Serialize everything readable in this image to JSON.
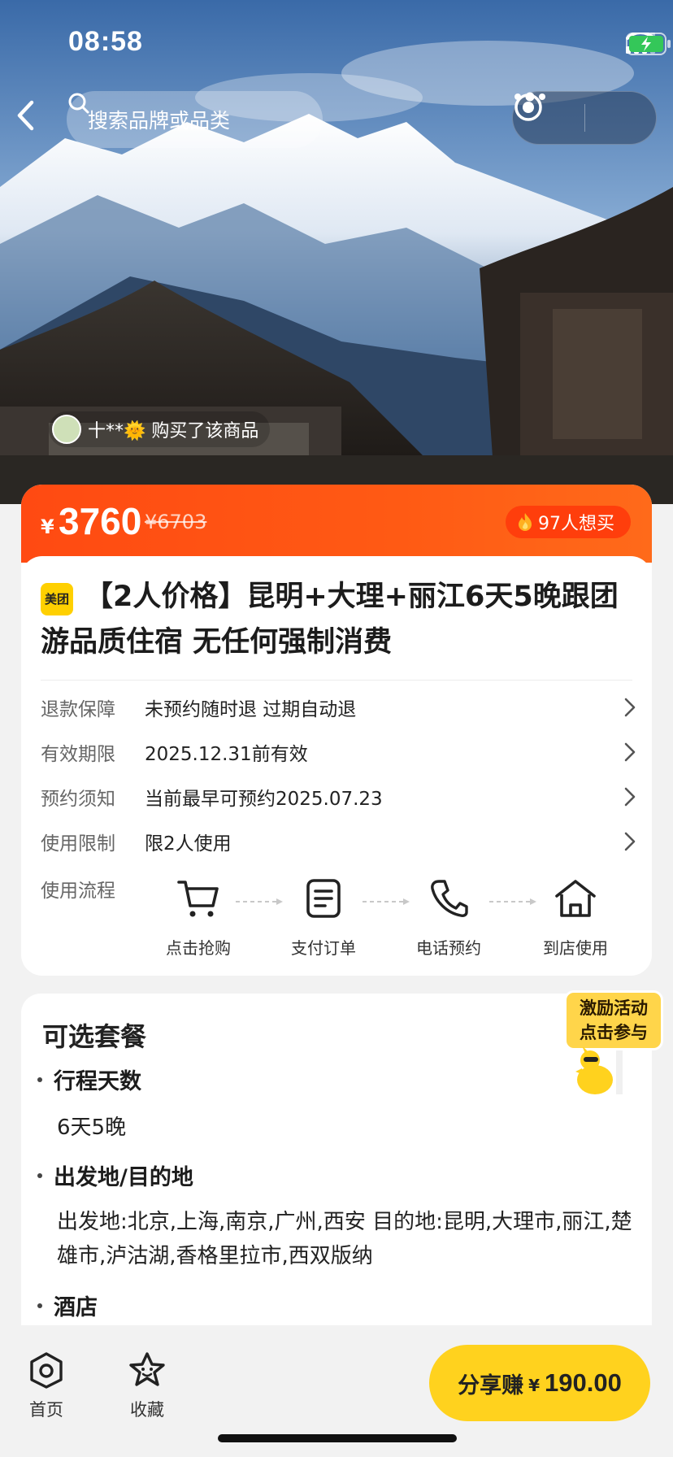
{
  "status_bar": {
    "time": "08:58"
  },
  "header": {
    "search_placeholder": "搜索品牌或品类"
  },
  "hero": {
    "buyer_ticker": "十**🌞 购买了该商品"
  },
  "price": {
    "currency": "¥",
    "current": "3760",
    "original": "¥6703",
    "want_count": "97人想买",
    "accent_color": "#ff4a12"
  },
  "product": {
    "brand_badge": "美团",
    "title": "【2人价格】昆明+大理+丽江6天5晚跟团游品质住宿 无任何强制消费"
  },
  "info_rows": [
    {
      "label": "退款保障",
      "value": "未预约随时退 过期自动退"
    },
    {
      "label": "有效期限",
      "value": "2025.12.31前有效"
    },
    {
      "label": "预约须知",
      "value": "当前最早可预约2025.07.23"
    },
    {
      "label": "使用限制",
      "value": "限2人使用"
    }
  ],
  "process": {
    "label": "使用流程",
    "steps": [
      {
        "label": "点击抢购",
        "icon": "cart-icon"
      },
      {
        "label": "支付订单",
        "icon": "document-icon"
      },
      {
        "label": "电话预约",
        "icon": "phone-icon"
      },
      {
        "label": "到店使用",
        "icon": "home-icon"
      }
    ]
  },
  "options": {
    "title": "可选套餐",
    "sections": [
      {
        "heading": "行程天数",
        "body": "6天5晚"
      },
      {
        "heading": "出发地/目的地",
        "body": "出发地:北京,上海,南京,广州,西安 目的地:昆明,大理市,丽江,楚雄市,泸沽湖,香格里拉市,西双版纳"
      },
      {
        "heading": "酒店",
        "body": ""
      }
    ]
  },
  "promo": {
    "line1": "激励活动",
    "line2": "点击参与"
  },
  "bottom_bar": {
    "tabs": [
      {
        "label": "首页",
        "icon": "home-tab-icon"
      },
      {
        "label": "收藏",
        "icon": "star-icon"
      }
    ],
    "share_label": "分享赚",
    "share_currency": "¥",
    "share_amount": "190.00",
    "share_color": "#ffd21e"
  }
}
